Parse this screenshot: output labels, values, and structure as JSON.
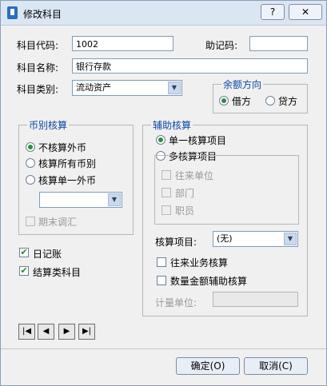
{
  "window": {
    "title": "修改科目",
    "help_label": "?",
    "close_label": "✕"
  },
  "form": {
    "code_label": "科目代码:",
    "code_value": "1002",
    "mnemonic_label": "助记码:",
    "mnemonic_value": "",
    "name_label": "科目名称:",
    "name_value": "银行存款",
    "category_label": "科目类别:",
    "category_value": "流动资产"
  },
  "balance": {
    "title": "余额方向",
    "debit": "借方",
    "credit": "贷方",
    "selected": "debit"
  },
  "currency": {
    "title": "币别核算",
    "options": [
      "不核算外币",
      "核算所有币别",
      "核算单一外币"
    ],
    "selected": 0,
    "single_currency_value": "",
    "period_adjust": "期末调汇"
  },
  "aux": {
    "title": "辅助核算",
    "single": "单一核算项目",
    "multi": "多核算项目",
    "multi_items": [
      "往来单位",
      "部门",
      "职员"
    ],
    "item_label": "核算项目:",
    "item_value": "(无)",
    "business_check": "往来业务核算",
    "quantity_check": "数量金额辅助核算",
    "unit_label": "计量单位:",
    "unit_value": ""
  },
  "flags": {
    "journal": "日记账",
    "settlement": "结算类科目"
  },
  "nav": {
    "first": "|◀",
    "prev": "◀",
    "next": "▶",
    "last": "▶|"
  },
  "buttons": {
    "ok": "确定(O)",
    "cancel": "取消(C)"
  },
  "colors": {
    "group_title": "#0a47a8",
    "check_mark": "#1f8b2b",
    "radio_dot": "#2c8f3b"
  }
}
